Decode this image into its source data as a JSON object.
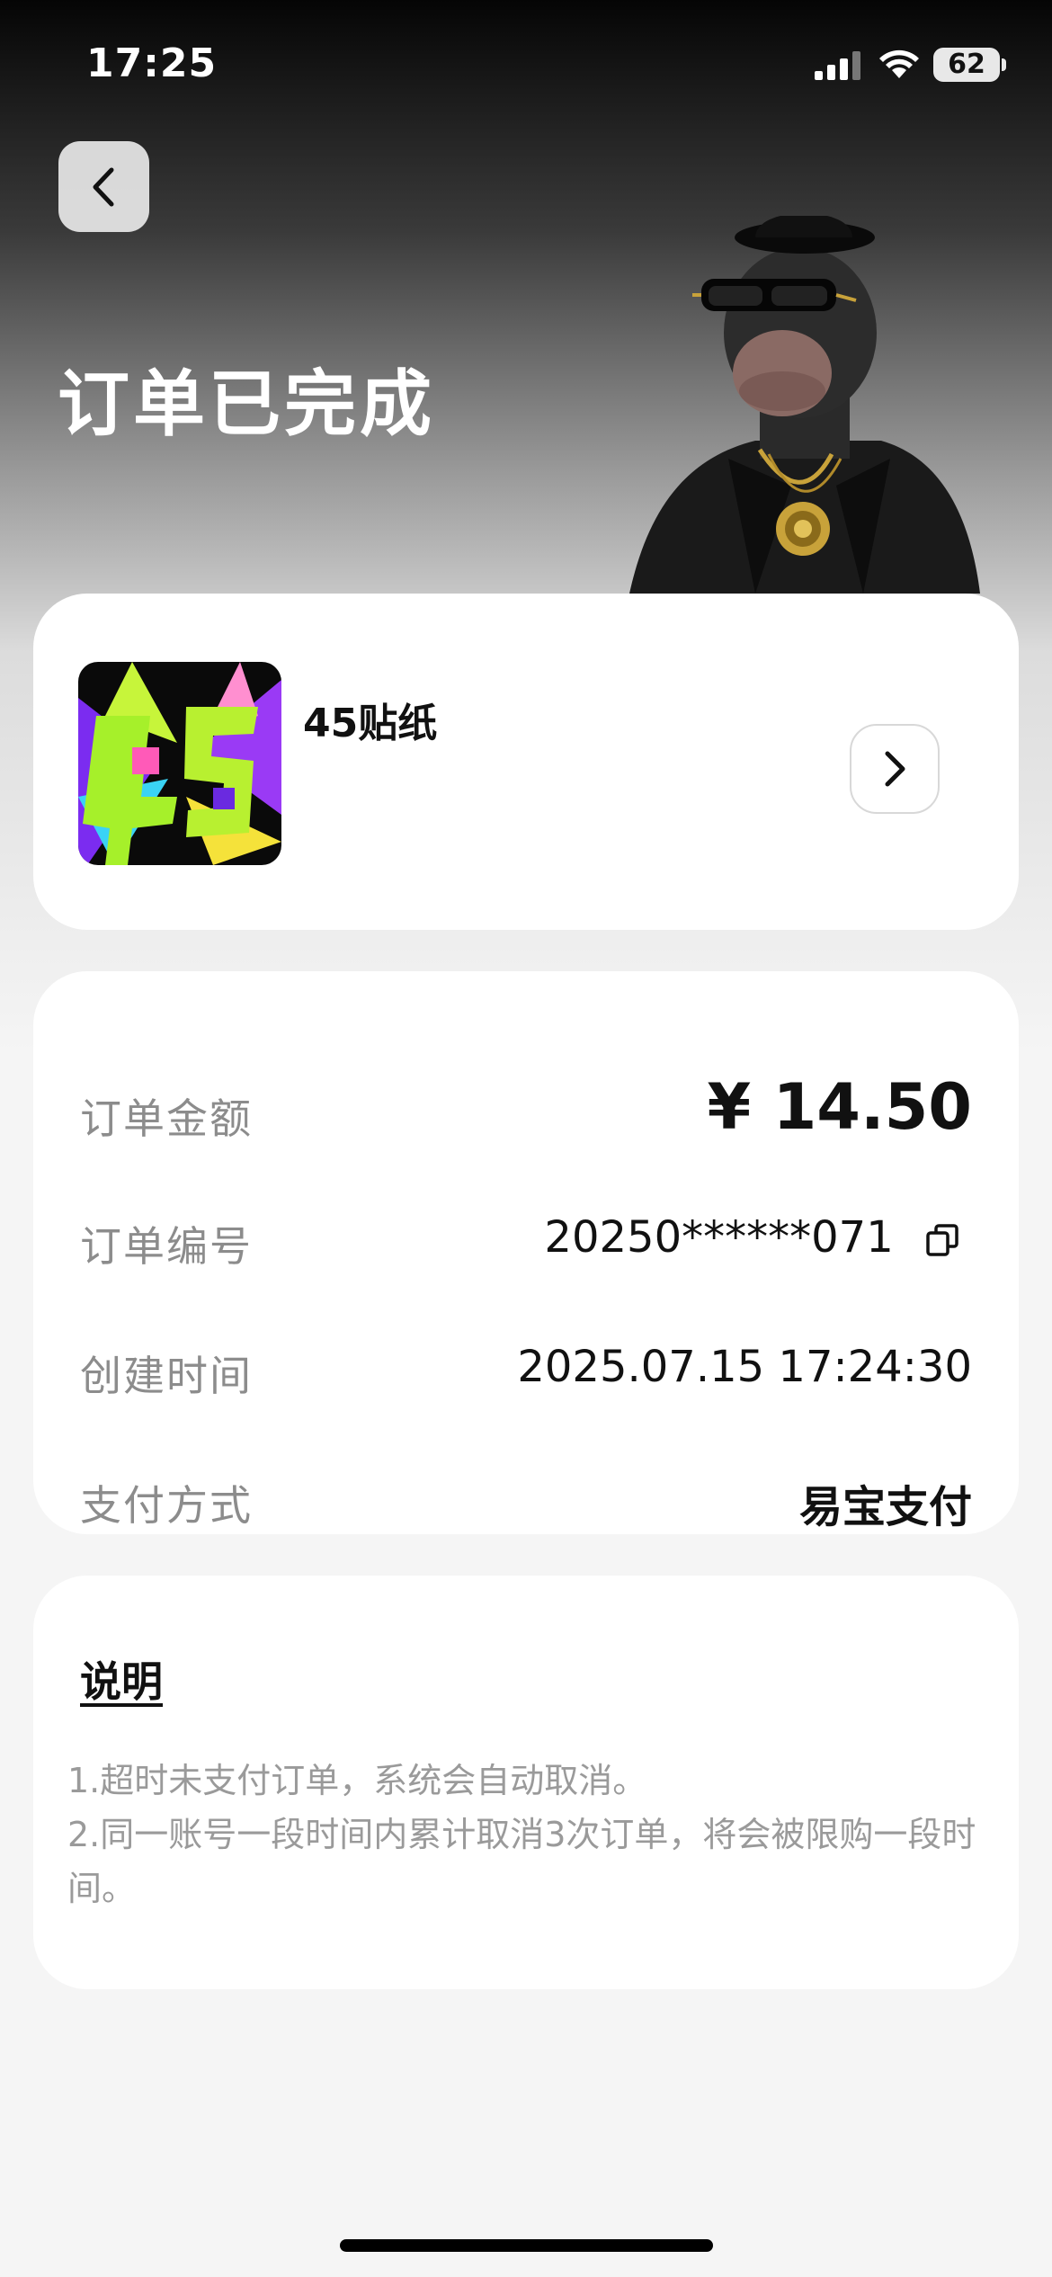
{
  "status_bar": {
    "time": "17:25",
    "battery": "62"
  },
  "page": {
    "title": "订单已完成"
  },
  "product": {
    "name": "45贴纸"
  },
  "order": {
    "amount_label": "订单金额",
    "amount_value": "¥ 14.50",
    "number_label": "订单编号",
    "number_value": "20250******071",
    "created_label": "创建时间",
    "created_value": "2025.07.15 17:24:30",
    "payment_label": "支付方式",
    "payment_value": "易宝支付"
  },
  "notes": {
    "title": "说明",
    "line1": "1.超时未支付订单，系统会自动取消。",
    "line2": "2.同一账号一段时间内累计取消3次订单，将会被限购一段时间。"
  },
  "icons": [
    "signal-icon",
    "wifi-icon",
    "battery-icon",
    "back-arrow-icon",
    "chevron-right-icon",
    "copy-icon"
  ]
}
